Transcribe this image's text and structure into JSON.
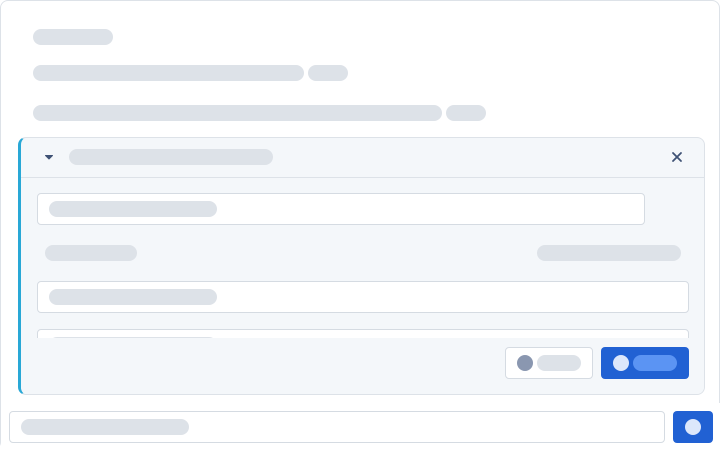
{
  "colors": {
    "skeleton": "#dde2e8",
    "panel_bg": "#f4f7fa",
    "panel_accent": "#29a8d6",
    "primary": "#2161d3",
    "primary_skeleton": "#5b94f3",
    "primary_dot": "#dce7fb",
    "secondary_dot": "#8a97b0",
    "border": "#d5dbe2"
  },
  "icons": {
    "collapse": "chevron-down-icon",
    "close": "close-icon",
    "secondary_action": "circle-icon",
    "primary_action": "circle-icon",
    "send": "circle-icon"
  }
}
